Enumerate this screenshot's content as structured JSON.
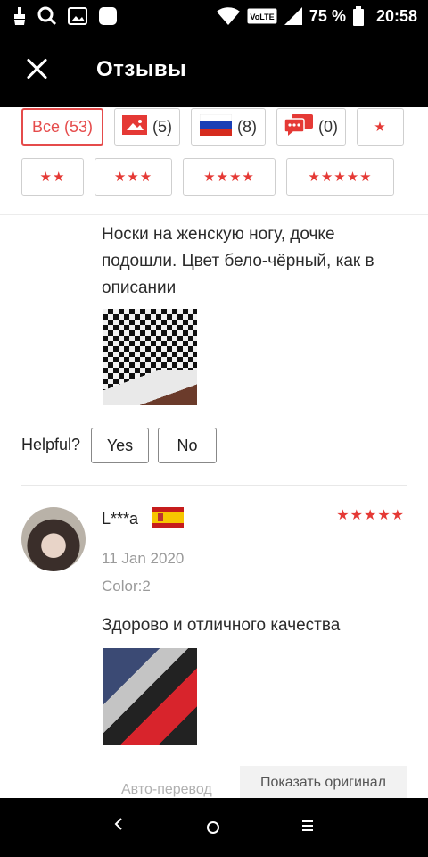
{
  "status_bar": {
    "battery_percent": "75 %",
    "time": "20:58",
    "network_label": "VoLTE",
    "icons": [
      "cleaner-icon",
      "search-icon",
      "gallery-icon",
      "app-icon",
      "wifi-icon",
      "volte-icon",
      "signal-icon",
      "battery-icon"
    ]
  },
  "appbar": {
    "title": "Отзывы"
  },
  "filters": {
    "all_label": "Все (53)",
    "photo_count": "(5)",
    "russia_count": "(8)",
    "comment_count": "(0)",
    "one_star": "★",
    "two_stars": "★★",
    "three_stars": "★★★",
    "four_stars": "★★★★",
    "five_stars": "★★★★★"
  },
  "review1": {
    "text": "Носки на женскую ногу, дочке подошли. Цвет бело-чёрный, как в описании",
    "helpful_label": "Helpful?",
    "yes_label": "Yes",
    "no_label": "No"
  },
  "review2": {
    "author": "L***a",
    "rating_stars": "★★★★★",
    "rating": 5,
    "date": "11 Jan 2020",
    "color": "Color:2",
    "text": "Здорово и отличного качества",
    "auto_translate_label": "Авто-перевод",
    "show_original_label": "Показать оригинал"
  },
  "colors": {
    "accent": "#e54b4b",
    "stars": "#e53935",
    "bars": "#000000"
  }
}
